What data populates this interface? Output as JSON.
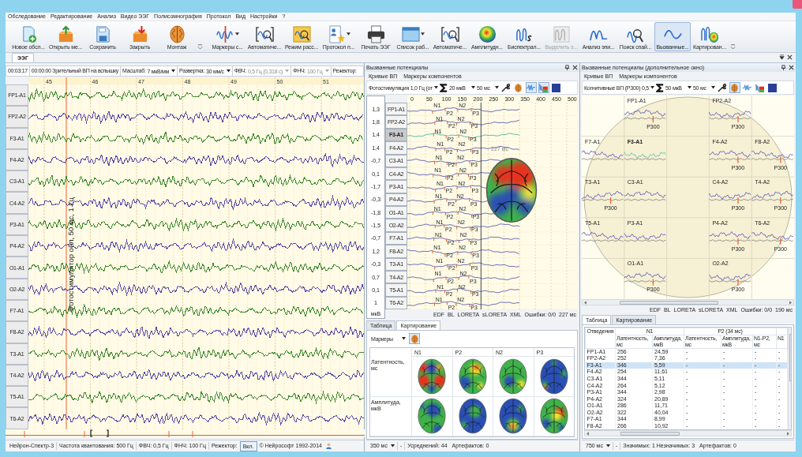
{
  "menu": [
    "Обследование",
    "Редактирование",
    "Анализ",
    "Видео ЭЭГ",
    "Полисомнография",
    "Протокол",
    "Вид",
    "Настройки",
    "?"
  ],
  "toolbar": {
    "groups": [
      [
        {
          "kind": "new-exam",
          "label": "Новое обсл...",
          "dropdown": false,
          "selected": false,
          "disabled": false
        },
        {
          "kind": "open-exam",
          "label": "Открыть ме...",
          "dropdown": false,
          "selected": false,
          "disabled": false
        },
        {
          "kind": "save",
          "label": "Сохранить",
          "dropdown": false,
          "selected": false,
          "disabled": false
        },
        {
          "kind": "close-exam",
          "label": "Закрыть",
          "dropdown": false,
          "selected": false,
          "disabled": false
        },
        {
          "kind": "montage",
          "label": "Монтаж",
          "dropdown": false,
          "selected": false,
          "disabled": false
        }
      ],
      [
        {
          "kind": "markers",
          "label": "Маркеры с...",
          "dropdown": true,
          "selected": false,
          "disabled": false
        },
        {
          "kind": "auto-detect",
          "label": "Автоматиче...",
          "dropdown": false,
          "selected": false,
          "disabled": false
        },
        {
          "kind": "review",
          "label": "Режим расс...",
          "dropdown": false,
          "selected": false,
          "disabled": false
        },
        {
          "kind": "protocol",
          "label": "Протокол п...",
          "dropdown": true,
          "selected": false,
          "disabled": false
        },
        {
          "kind": "print",
          "label": "Печать ЭЭГ",
          "dropdown": false,
          "selected": false,
          "disabled": false
        },
        {
          "kind": "work-list",
          "label": "Список раб...",
          "dropdown": true,
          "selected": false,
          "disabled": false
        },
        {
          "kind": "auto-analysis",
          "label": "Автоматиче...",
          "dropdown": false,
          "selected": false,
          "disabled": false
        },
        {
          "kind": "amplitude-map",
          "label": "Амплитудн...",
          "dropdown": false,
          "selected": false,
          "disabled": false
        },
        {
          "kind": "bispectral",
          "label": "Биспектрал...",
          "dropdown": false,
          "selected": false,
          "disabled": false
        },
        {
          "kind": "select-epoch",
          "label": "Выделить э...",
          "dropdown": false,
          "selected": false,
          "disabled": true
        },
        {
          "kind": "epi-analysis",
          "label": "Анализ эпи...",
          "dropdown": false,
          "selected": false,
          "disabled": false
        },
        {
          "kind": "spike-search",
          "label": "Поиск спай...",
          "dropdown": false,
          "selected": false,
          "disabled": false
        },
        {
          "kind": "evoked",
          "label": "Вызванные...",
          "dropdown": false,
          "selected": true,
          "disabled": false
        },
        {
          "kind": "mapping",
          "label": "Картирован...",
          "dropdown": false,
          "selected": false,
          "disabled": false
        }
      ]
    ]
  },
  "document_tabs": [
    {
      "label": "ЭЭГ",
      "selected": true
    }
  ],
  "eeg": {
    "time": "00:03:17",
    "event": "00:00:00 Зрительный ВП на вспышку",
    "settings": [
      {
        "label": "Масштаб:",
        "value": "7 мкВ/мм",
        "disabled": false
      },
      {
        "label": "Развертка:",
        "value": "30 мм/с",
        "disabled": false
      },
      {
        "label": "ФВЧ:",
        "value": "0,5 Гц (0,318 с)",
        "disabled": true
      },
      {
        "label": "ФНЧ:",
        "value": "100 Гц",
        "disabled": true
      }
    ],
    "notch_label": "Режектор:",
    "seconds": [
      "45",
      "46",
      "47",
      "48",
      "49",
      "50",
      "51"
    ],
    "stimulus": "Фотостимулятор обл, 50 мс, 1 Гц",
    "channels": [
      {
        "name": "FP1-A1",
        "color": "#3f8a2e"
      },
      {
        "name": "FP2-A2",
        "color": "#5a4aa8"
      },
      {
        "name": "F3-A1",
        "color": "#3f8a2e"
      },
      {
        "name": "F4-A2",
        "color": "#5a4aa8"
      },
      {
        "name": "C3-A1",
        "color": "#3f8a2e"
      },
      {
        "name": "C4-A2",
        "color": "#5a4aa8"
      },
      {
        "name": "P3-A1",
        "color": "#3f8a2e"
      },
      {
        "name": "P4-A2",
        "color": "#5a4aa8"
      },
      {
        "name": "O1-A1",
        "color": "#3f8a2e"
      },
      {
        "name": "O2-A2",
        "color": "#5a4aa8"
      },
      {
        "name": "F7-A1",
        "color": "#3f8a2e"
      },
      {
        "name": "F8-A2",
        "color": "#5a4aa8"
      },
      {
        "name": "T3-A1",
        "color": "#3f8a2e"
      },
      {
        "name": "T4-A2",
        "color": "#5a4aa8"
      },
      {
        "name": "T5-A1",
        "color": "#3f8a2e"
      },
      {
        "name": "T6-A2",
        "color": "#5a4aa8"
      }
    ],
    "status": {
      "device": "Нейрон-Спектр-3",
      "sampling": "Частота квантования: 500 Гц",
      "highpass": "ФВЧ: 0,5 Гц",
      "lowpass": "ФНЧ: 100 Гц",
      "notch_label": "Режектор:",
      "notch_button": "Вкл.",
      "copyright": "© Нейрософт 1992-2014"
    }
  },
  "evoked": {
    "title": "Вызванные потенциалы",
    "menu": [
      "Кривые ВП",
      "Маркеры компонентов"
    ],
    "stimulus": "Фотостимуляция 1,0 Гц (от",
    "amplitude": "20 мкВ",
    "sweep": "50 мс",
    "tools": [
      {
        "kind": "wrench",
        "selected": false
      },
      {
        "kind": "brain",
        "selected": false
      },
      {
        "kind": "waves",
        "selected": true
      },
      {
        "kind": "wave-map",
        "selected": true
      },
      {
        "kind": "square",
        "selected": false
      }
    ],
    "xticks": [
      "0",
      "50",
      "100",
      "150",
      "200",
      "250",
      "300",
      "350",
      "400",
      "450",
      "500"
    ],
    "unit": "мкВ",
    "map_time": "227 мс",
    "channels": [
      {
        "name": "FP1-A1",
        "value": "1,3",
        "selected": false,
        "markers": [
          "N1",
          "P2",
          "N2",
          "P3"
        ]
      },
      {
        "name": "FP2-A2",
        "value": "1,8",
        "selected": false,
        "markers": [
          "N1",
          "P2",
          "N2",
          "P3"
        ]
      },
      {
        "name": "F3-A1",
        "value": "1,4",
        "selected": true,
        "markers": [
          "N1",
          "P2",
          "N2",
          "P3"
        ]
      },
      {
        "name": "F4-A2",
        "value": "1,4",
        "selected": false,
        "markers": [
          "N1",
          "P2",
          "N2",
          "P3"
        ]
      },
      {
        "name": "C3-A1",
        "value": "-0,7",
        "selected": false,
        "markers": [
          "N1",
          "P2",
          "N2",
          "P3"
        ]
      },
      {
        "name": "C4-A2",
        "value": "0,1",
        "selected": false,
        "markers": [
          "N1",
          "P2",
          "N2",
          "P3"
        ]
      },
      {
        "name": "P3-A1",
        "value": "-1,7",
        "selected": false,
        "markers": [
          "N1",
          "P2",
          "N2",
          "P3"
        ]
      },
      {
        "name": "P4-A2",
        "value": "-0,3",
        "selected": false,
        "markers": [
          "N1",
          "P2",
          "N2",
          "P3"
        ]
      },
      {
        "name": "O1-A1",
        "value": "-1,8",
        "selected": false,
        "markers": [
          "N1",
          "P2",
          "N2",
          "P3"
        ]
      },
      {
        "name": "O2-A2",
        "value": "-1,5",
        "selected": false,
        "markers": [
          "N1",
          "P2",
          "N2",
          "P3"
        ]
      },
      {
        "name": "F7-A1",
        "value": "-0,7",
        "selected": false,
        "markers": [
          "N1",
          "P2",
          "N2",
          "P3"
        ]
      },
      {
        "name": "F8-A2",
        "value": "1,2",
        "selected": false,
        "markers": [
          "N1",
          "P2",
          "N2",
          "P3"
        ]
      },
      {
        "name": "T3-A1",
        "value": "-0,3",
        "selected": false,
        "markers": [
          "N1",
          "P2",
          "N2",
          "P3"
        ]
      },
      {
        "name": "T4-A2",
        "value": "0,7",
        "selected": false,
        "markers": [
          "N1",
          "P2",
          "N2",
          "P3"
        ]
      },
      {
        "name": "T5-A1",
        "value": "0,1",
        "selected": false,
        "markers": [
          "N1",
          "P2",
          "N2",
          "P3"
        ]
      },
      {
        "name": "T6-A2",
        "value": "1",
        "selected": false,
        "markers": [
          "N1",
          "P2",
          "N2",
          "P3"
        ]
      }
    ],
    "footer": {
      "links": [
        "EDF",
        "BL",
        "LORETA",
        "sLORETA",
        "XML"
      ],
      "errors": "Ошибки: 0/0",
      "time": "227 мс"
    },
    "tabs": [
      {
        "label": "Таблица",
        "selected": false
      },
      {
        "label": "Картирование",
        "selected": true
      }
    ],
    "mapping": {
      "selector": "Маркеры",
      "columns": [
        "N1",
        "P2",
        "N2",
        "P3"
      ],
      "rows": [
        "Латентность, мс",
        "Амплитуда, мкВ"
      ]
    },
    "status": {
      "window": "350 мс",
      "dash": "-",
      "averages": "Усреднений: 44",
      "artifacts": "Артефактов: 0"
    }
  },
  "evoked_extra": {
    "title": "Вызванные потенциалы (дополнительное окно)",
    "menu": [
      "Кривые ВП",
      "Маркеры компонентов"
    ],
    "stimulus": "Когнитивные ВП (P300) 0,5",
    "amplitude": "50 мкВ",
    "sweep": "50 мс",
    "tools": [
      {
        "kind": "wrench",
        "selected": false
      },
      {
        "kind": "brain",
        "selected": true
      },
      {
        "kind": "waves",
        "selected": false
      },
      {
        "kind": "wave-map",
        "selected": false
      },
      {
        "kind": "square",
        "selected": false
      }
    ],
    "head_map": [
      [
        {
          "kind": "empty"
        },
        {
          "kind": "lead",
          "name": "FP1-A1",
          "selected": false,
          "marker": "P300"
        },
        {
          "kind": "empty"
        },
        {
          "kind": "lead",
          "name": "FP2-A2",
          "selected": false,
          "marker": "P300"
        },
        {
          "kind": "empty"
        }
      ],
      [
        {
          "kind": "lead",
          "name": "F7-A1",
          "selected": false
        },
        {
          "kind": "lead",
          "name": "F3-A1",
          "selected": true
        },
        {
          "kind": "empty"
        },
        {
          "kind": "lead",
          "name": "F4-A2",
          "selected": false,
          "marker": "P300"
        },
        {
          "kind": "lead",
          "name": "F8-A2",
          "selected": false,
          "marker": "P300"
        }
      ],
      [
        {
          "kind": "lead",
          "name": "T3-A1",
          "selected": false,
          "marker": "P300"
        },
        {
          "kind": "lead",
          "name": "C3-A1",
          "selected": false
        },
        {
          "kind": "empty"
        },
        {
          "kind": "lead",
          "name": "C4-A2",
          "selected": false,
          "marker": "P300"
        },
        {
          "kind": "lead",
          "name": "T4-A2",
          "selected": false,
          "marker": "P300"
        }
      ],
      [
        {
          "kind": "lead",
          "name": "T5-A1",
          "selected": false
        },
        {
          "kind": "lead",
          "name": "P3-A1",
          "selected": false
        },
        {
          "kind": "empty"
        },
        {
          "kind": "lead",
          "name": "P4-A2",
          "selected": false,
          "marker": "P300"
        },
        {
          "kind": "lead",
          "name": "T6-A2",
          "selected": false,
          "marker": "P300"
        }
      ],
      [
        {
          "kind": "empty"
        },
        {
          "kind": "lead",
          "name": "O1-A1",
          "selected": false,
          "marker": "P300"
        },
        {
          "kind": "empty"
        },
        {
          "kind": "lead",
          "name": "O2-A2",
          "selected": false,
          "marker": "P300"
        },
        {
          "kind": "empty"
        }
      ]
    ],
    "footer": {
      "links": [
        "EDF",
        "BL",
        "LORETA",
        "sLORETA",
        "XML"
      ],
      "errors": "Ошибки: 0/0",
      "time": "190 мс"
    },
    "tabs": [
      {
        "label": "Таблица",
        "selected": true
      },
      {
        "label": "Картирование",
        "selected": false
      }
    ],
    "table": {
      "lead_header": "Отведения",
      "groups": [
        {
          "label": "N1",
          "columns": [
            "Латентность, мс",
            "Амплитуда, мкВ"
          ]
        },
        {
          "label": "P2 (34 мс)",
          "columns": [
            "Латентность, мс",
            "Амплитуда, мкВ",
            "N1-P2, мс"
          ]
        },
        {
          "columns": [
            "N1"
          ]
        }
      ],
      "rows": [
        {
          "selected": false,
          "cells": [
            "FP1-A1",
            "256",
            "24,59",
            "-",
            "-",
            "-",
            "-"
          ]
        },
        {
          "selected": false,
          "cells": [
            "FP2-A2",
            "252",
            "7,36",
            "-",
            "-",
            "-",
            "-"
          ]
        },
        {
          "selected": true,
          "cells": [
            "F3-A1",
            "346",
            "5,59",
            "-",
            "-",
            "-",
            "-"
          ]
        },
        {
          "selected": false,
          "cells": [
            "F4-A2",
            "254",
            "11,61",
            "-",
            "-",
            "-",
            "-"
          ]
        },
        {
          "selected": false,
          "cells": [
            "C3-A1",
            "344",
            "5,11",
            "-",
            "-",
            "-",
            "-"
          ]
        },
        {
          "selected": false,
          "cells": [
            "C4-A2",
            "264",
            "5,12",
            "-",
            "-",
            "-",
            "-"
          ]
        },
        {
          "selected": false,
          "cells": [
            "P3-A1",
            "344",
            "2,98",
            "-",
            "-",
            "-",
            "-"
          ]
        },
        {
          "selected": false,
          "cells": [
            "P4-A2",
            "324",
            "20,89",
            "-",
            "-",
            "-",
            "-"
          ]
        },
        {
          "selected": false,
          "cells": [
            "O1-A1",
            "286",
            "11,71",
            "-",
            "-",
            "-",
            "-"
          ]
        },
        {
          "selected": false,
          "cells": [
            "O2-A2",
            "322",
            "40,04",
            "-",
            "-",
            "-",
            "-"
          ]
        },
        {
          "selected": false,
          "cells": [
            "F7-A1",
            "344",
            "8,99",
            "-",
            "-",
            "-",
            "-"
          ]
        },
        {
          "selected": false,
          "cells": [
            "F8-A2",
            "266",
            "10,92",
            "-",
            "-",
            "-",
            "-"
          ]
        }
      ]
    },
    "status": {
      "window": "750 мс",
      "dash": "-",
      "significance": "Значимых: 1 Незначимых: 3",
      "artifacts": "Артефактов: 0"
    }
  }
}
